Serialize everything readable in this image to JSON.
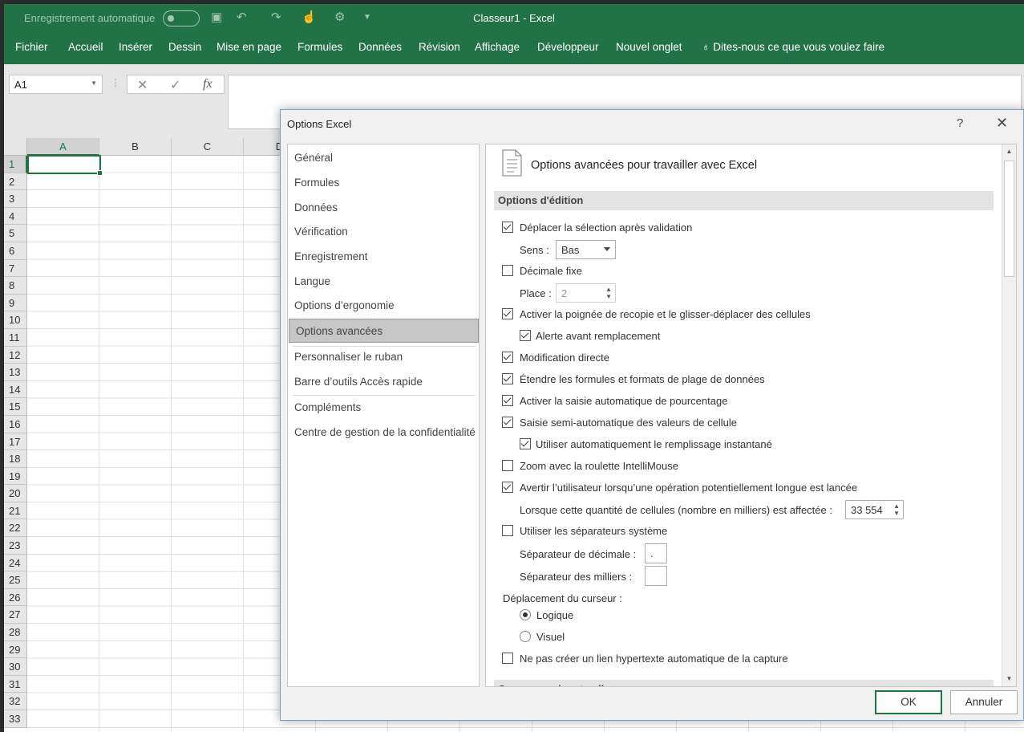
{
  "titlebar": {
    "autosave_label": "Enregistrement automatique",
    "window_title": "Classeur1  -  Excel"
  },
  "ribbon": {
    "tabs": [
      "Fichier",
      "Accueil",
      "Insérer",
      "Dessin",
      "Mise en page",
      "Formules",
      "Données",
      "Révision",
      "Affichage",
      "Développeur",
      "Nouvel onglet"
    ],
    "tell_me": "Dites-nous ce que vous voulez faire"
  },
  "formula_bar": {
    "name_box": "A1",
    "cancel_glyph": "✕",
    "enter_glyph": "✓",
    "fx_glyph": "fx"
  },
  "grid": {
    "columns": [
      "A",
      "B",
      "C",
      "D"
    ],
    "rows": [
      "1",
      "2",
      "3",
      "4",
      "5",
      "6",
      "7",
      "8",
      "9",
      "10",
      "11",
      "12",
      "13",
      "14",
      "15",
      "16",
      "17",
      "18",
      "19",
      "20",
      "21",
      "22",
      "23",
      "24",
      "25",
      "26",
      "27",
      "28",
      "29",
      "30",
      "31",
      "32",
      "33"
    ]
  },
  "dialog": {
    "title": "Options Excel",
    "help": "?",
    "close": "✕",
    "nav": [
      "Général",
      "Formules",
      "Données",
      "Vérification",
      "Enregistrement",
      "Langue",
      "Options d’ergonomie",
      "Options avancées",
      "Personnaliser le ruban",
      "Barre d’outils Accès rapide",
      "Compléments",
      "Centre de gestion de la confidentialité"
    ],
    "nav_active": "Options avancées",
    "panel_title": "Options avancées pour travailler avec Excel",
    "section_edit": "Options d'édition",
    "section_next": "Couper, copier et coller",
    "options": {
      "move_after_enter": {
        "label": "Déplacer la sélection après validation",
        "checked": true
      },
      "direction_label": "Sens :",
      "direction_value": "Bas",
      "fixed_decimal": {
        "label": "Décimale fixe",
        "checked": false
      },
      "places_label": "Place :",
      "places_value": "2",
      "fill_handle": {
        "label": "Activer la poignée de recopie et le glisser-déplacer des cellules",
        "checked": true
      },
      "alert_overwrite": {
        "label": "Alerte avant remplacement",
        "checked": true
      },
      "edit_in_cell": {
        "label": "Modification directe",
        "checked": true
      },
      "extend_formats": {
        "label": "Étendre les formules et formats de plage de données",
        "checked": true
      },
      "auto_percent": {
        "label": "Activer la saisie automatique de pourcentage",
        "checked": true
      },
      "autocomplete": {
        "label": "Saisie semi-automatique des valeurs de cellule",
        "checked": true
      },
      "flash_fill": {
        "label": "Utiliser automatiquement le remplissage instantané",
        "checked": true
      },
      "zoom_intellimouse": {
        "label": "Zoom avec la roulette IntelliMouse",
        "checked": false
      },
      "alert_long_op": {
        "label": "Avertir l’utilisateur lorsqu’une opération potentiellement longue est lancée",
        "checked": true
      },
      "cells_threshold_label": "Lorsque cette quantité de cellules (nombre en milliers) est affectée :",
      "cells_threshold_value": "33 554",
      "system_separators": {
        "label": "Utiliser les séparateurs système",
        "checked": false
      },
      "decimal_sep_label": "Séparateur de décimale :",
      "decimal_sep_value": ".",
      "thousands_sep_label": "Séparateur des milliers :",
      "thousands_sep_value": "",
      "cursor_movement_label": "Déplacement du curseur :",
      "cursor_logical": {
        "label": "Logique",
        "selected": true
      },
      "cursor_visual": {
        "label": "Visuel",
        "selected": false
      },
      "no_hyperlink": {
        "label": "Ne pas créer un lien hypertexte automatique de la capture",
        "checked": false
      }
    },
    "ok_label": "OK",
    "cancel_label": "Annuler"
  },
  "colors": {
    "excel_green": "#217346",
    "dialog_bg": "#f0f0f0"
  }
}
